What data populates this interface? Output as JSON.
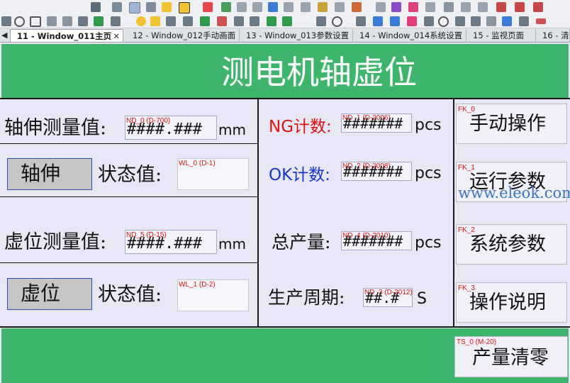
{
  "tabs": [
    {
      "label": "11 - Window_011主页",
      "active": true,
      "close": "✕"
    },
    {
      "label": "12 - Window_012手动画面"
    },
    {
      "label": "13 - Window_013参数设置"
    },
    {
      "label": "14 - Window_014系统设置"
    },
    {
      "label": "15 - 监视页面"
    },
    {
      "label": "16 - 清"
    }
  ],
  "tab_scroll_left": "◀",
  "screen": {
    "title": "测电机轴虚位",
    "watermark": "www.eleok.com",
    "left": {
      "shaft_measure_label": "轴伸测量值:",
      "shaft_measure_tag": "ND_0 (D-700)",
      "shaft_measure_value": "####.###",
      "shaft_measure_unit": "mm",
      "shaft_button": "轴伸",
      "shaft_state_label": "状态值:",
      "shaft_state_tag": "WL_0 (D-1)",
      "virtual_measure_label": "虚位测量值:",
      "virtual_measure_tag": "ND_5 (D-15)",
      "virtual_measure_value": "####.###",
      "virtual_measure_unit": "mm",
      "virtual_button": "虚位",
      "virtual_state_label": "状态值:",
      "virtual_state_tag": "WL_1 (D-2)"
    },
    "middle": {
      "ng_label": "NG计数:",
      "ng_tag": "ND_1 (D-2006)",
      "ng_value": "#######",
      "ng_unit": "pcs",
      "ok_label": "OK计数:",
      "ok_tag": "ND_2 (D-2008)",
      "ok_value": "#######",
      "ok_unit": "pcs",
      "total_label": "总产量:",
      "total_tag": "ND_4 (D-2010)",
      "total_value": "#######",
      "total_unit": "pcs",
      "cycle_label": "生产周期:",
      "cycle_tag": "ND_3 (D-2012)",
      "cycle_value": "##.#",
      "cycle_unit": "S"
    },
    "right": {
      "manual_tag": "FK_0",
      "manual_label": "手动操作",
      "params_tag": "FK_1",
      "params_label": "运行参数",
      "system_tag": "FK_2",
      "system_label": "系统参数",
      "help_tag": "FK_3",
      "help_label": "操作说明"
    },
    "reset_tag": "TS_0 (M-20)",
    "reset_label": "产量清零"
  },
  "colors": {
    "header_green": "#3db56a",
    "canvas_bg": "#e7e7f5",
    "ng_red": "#e01010",
    "ok_blue": "#1537d6",
    "tag_red": "#e01010"
  }
}
